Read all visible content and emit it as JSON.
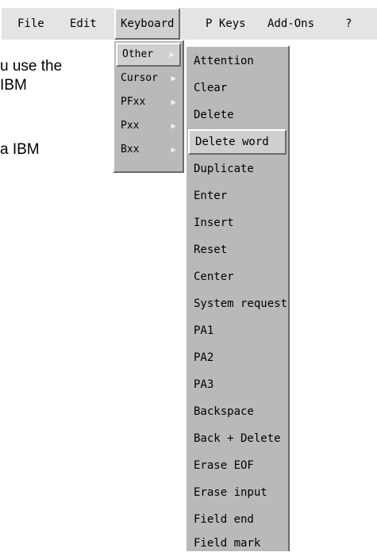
{
  "document": {
    "line1": "u use the",
    "line2": "IBM",
    "line3": "a IBM"
  },
  "menubar": {
    "items": [
      "File",
      "Edit",
      "Keyboard",
      "P Keys",
      "Add-Ons",
      "?"
    ],
    "active": "Keyboard"
  },
  "keyboard_submenu": {
    "items": [
      "Other",
      "Cursor",
      "PFxx",
      "Pxx",
      "Bxx"
    ],
    "active": "Other",
    "arrow": "▶"
  },
  "other_menu": {
    "items": [
      "Attention",
      "Clear",
      "Delete",
      "Delete word",
      "Duplicate",
      "Enter",
      "Insert",
      "Reset",
      "Center",
      "System request",
      "PA1",
      "PA2",
      "PA3",
      "Backspace",
      "Back + Delete",
      "Erase EOF",
      "Erase input",
      "Field end",
      "Field mark"
    ],
    "highlighted": "Delete word"
  }
}
